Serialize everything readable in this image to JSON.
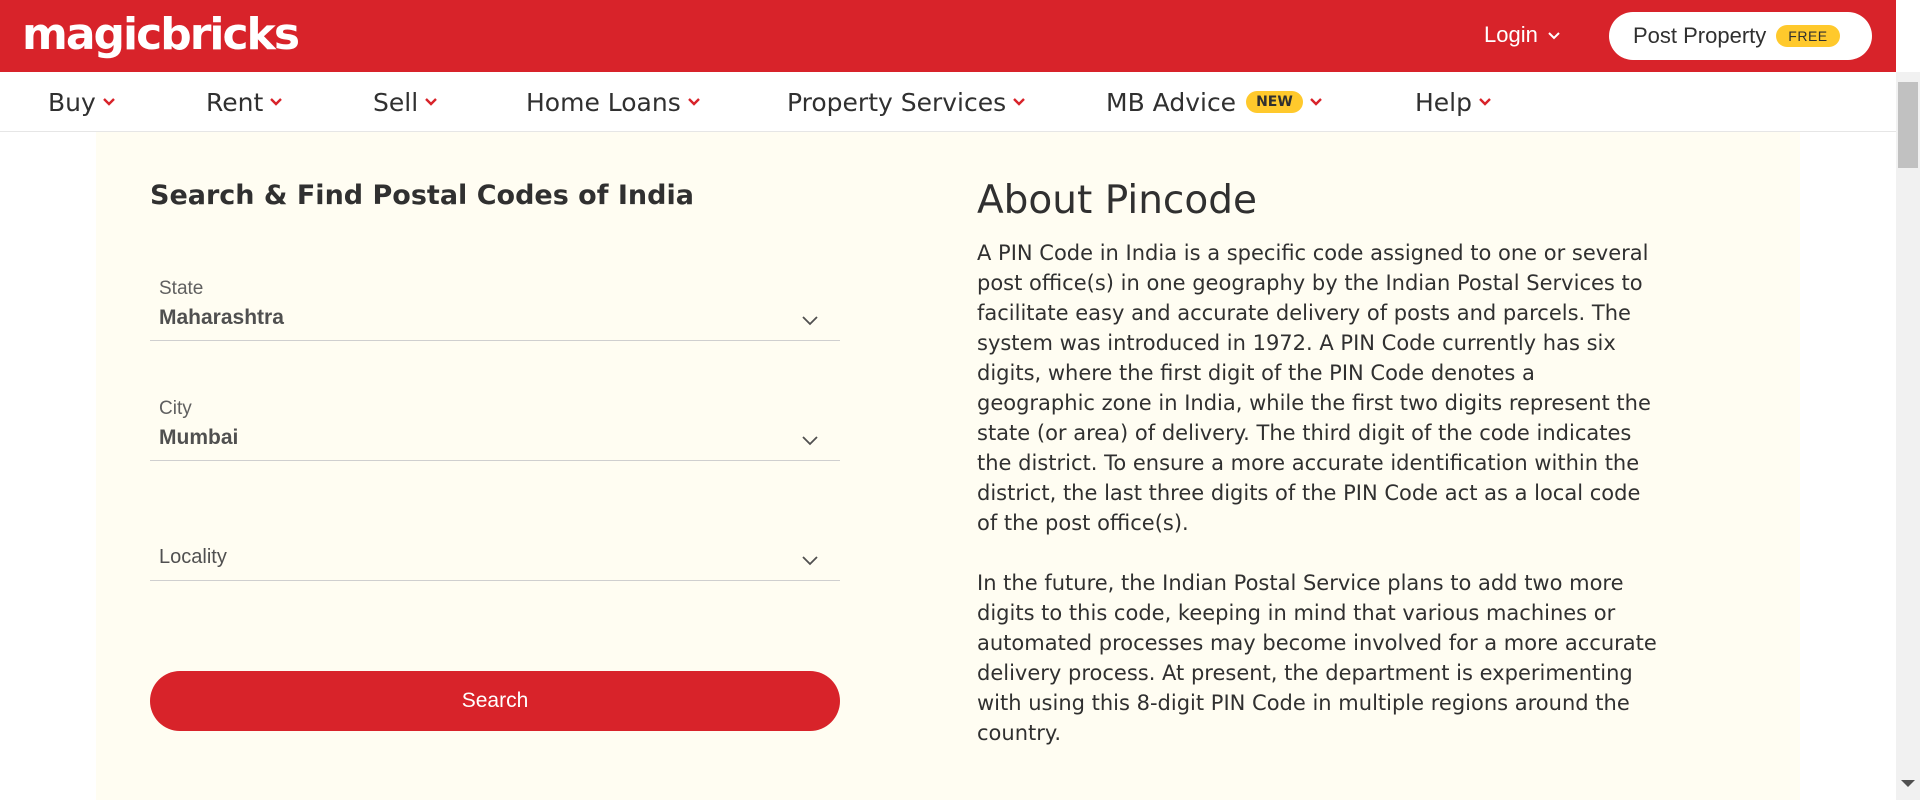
{
  "header": {
    "logo": "magicbricks",
    "login_label": "Login",
    "post_property_label": "Post Property",
    "free_badge": "FREE"
  },
  "nav": {
    "items": [
      {
        "label": "Buy"
      },
      {
        "label": "Rent"
      },
      {
        "label": "Sell"
      },
      {
        "label": "Home Loans"
      },
      {
        "label": "Property Services"
      },
      {
        "label": "MB Advice",
        "badge": "NEW"
      },
      {
        "label": "Help"
      }
    ]
  },
  "search": {
    "title": "Search & Find Postal Codes of India",
    "state_label": "State",
    "state_value": "Maharashtra",
    "city_label": "City",
    "city_value": "Mumbai",
    "locality_placeholder": "Locality",
    "search_label": "Search"
  },
  "about": {
    "title": "About Pincode",
    "para1": "A PIN Code in India is a specific code assigned to one or several post office(s) in one geography by the Indian Postal Services to facilitate easy and accurate delivery of posts and parcels. The system was introduced in 1972. A PIN Code currently has six digits, where the first digit of the PIN Code denotes a geographic zone in India, while the first two digits represent the state (or area) of delivery. The third digit of the code indicates the district. To ensure a more accurate identification within the district, the last three digits of the PIN Code act as a local code of the post office(s).",
    "para2": "In the future, the Indian Postal Service plans to add two more digits to this code, keeping in mind that various machines or automated processes may become involved for a more accurate delivery process. At present, the department is experimenting with using this 8-digit PIN Code in multiple regions around the country."
  },
  "colors": {
    "brand_red": "#d8232a",
    "badge_yellow": "#ffc92c",
    "panel_bg": "#fffdf2"
  }
}
